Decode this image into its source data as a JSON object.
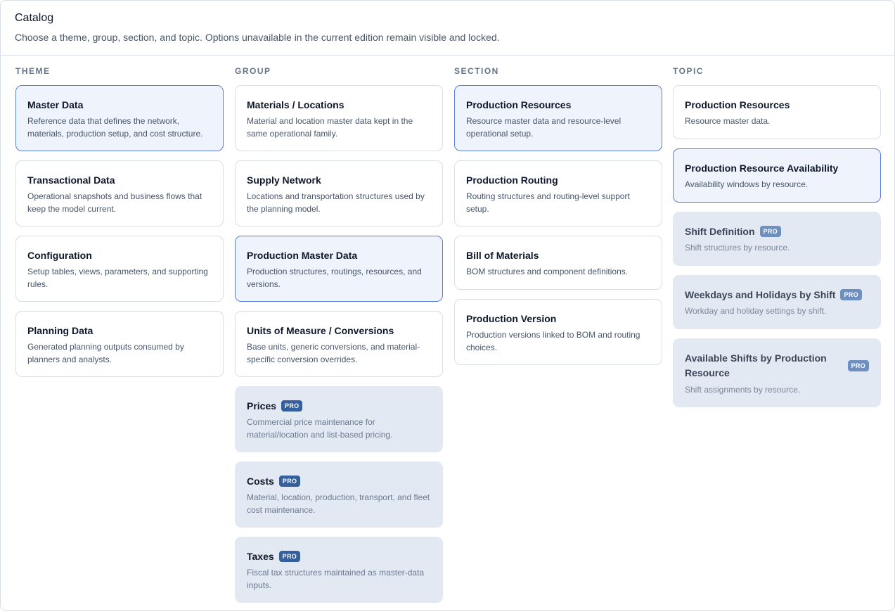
{
  "header": {
    "title": "Catalog",
    "subtitle": "Choose a theme, group, section, and topic. Options unavailable in the current edition remain visible and locked."
  },
  "pro_label": "PRO",
  "columns": {
    "theme": {
      "heading": "THEME",
      "items": [
        {
          "title": "Master Data",
          "desc": "Reference data that defines the network, materials, production setup, and cost structure.",
          "selected": true
        },
        {
          "title": "Transactional Data",
          "desc": "Operational snapshots and business flows that keep the model current."
        },
        {
          "title": "Configuration",
          "desc": "Setup tables, views, parameters, and supporting rules."
        },
        {
          "title": "Planning Data",
          "desc": "Generated planning outputs consumed by planners and analysts."
        }
      ]
    },
    "group": {
      "heading": "GROUP",
      "items": [
        {
          "title": "Materials / Locations",
          "desc": "Material and location master data kept in the same operational family."
        },
        {
          "title": "Supply Network",
          "desc": "Locations and transportation structures used by the planning model."
        },
        {
          "title": "Production Master Data",
          "desc": "Production structures, routings, resources, and versions.",
          "selected": true
        },
        {
          "title": "Units of Measure / Conversions",
          "desc": "Base units, generic conversions, and material-specific conversion overrides."
        },
        {
          "title": "Prices",
          "desc": "Commercial price maintenance for material/location and list-based pricing.",
          "locked": true
        },
        {
          "title": "Costs",
          "desc": "Material, location, production, transport, and fleet cost maintenance.",
          "locked": true
        },
        {
          "title": "Taxes",
          "desc": "Fiscal tax structures maintained as master-data inputs.",
          "locked": true
        }
      ]
    },
    "section": {
      "heading": "SECTION",
      "items": [
        {
          "title": "Production Resources",
          "desc": "Resource master data and resource-level operational setup.",
          "selected": true
        },
        {
          "title": "Production Routing",
          "desc": "Routing structures and routing-level support setup."
        },
        {
          "title": "Bill of Materials",
          "desc": "BOM structures and component definitions."
        },
        {
          "title": "Production Version",
          "desc": "Production versions linked to BOM and routing choices."
        }
      ]
    },
    "topic": {
      "heading": "TOPIC",
      "items": [
        {
          "title": "Production Resources",
          "desc": "Resource master data."
        },
        {
          "title": "Production Resource Availability",
          "desc": "Availability windows by resource.",
          "selected": true
        },
        {
          "title": "Shift Definition",
          "desc": "Shift structures by resource.",
          "locked": true
        },
        {
          "title": "Weekdays and Holidays by Shift",
          "desc": "Workday and holiday settings by shift.",
          "locked": true
        },
        {
          "title": "Available Shifts by Production Resource",
          "desc": "Shift assignments by resource.",
          "locked": true
        }
      ]
    }
  }
}
